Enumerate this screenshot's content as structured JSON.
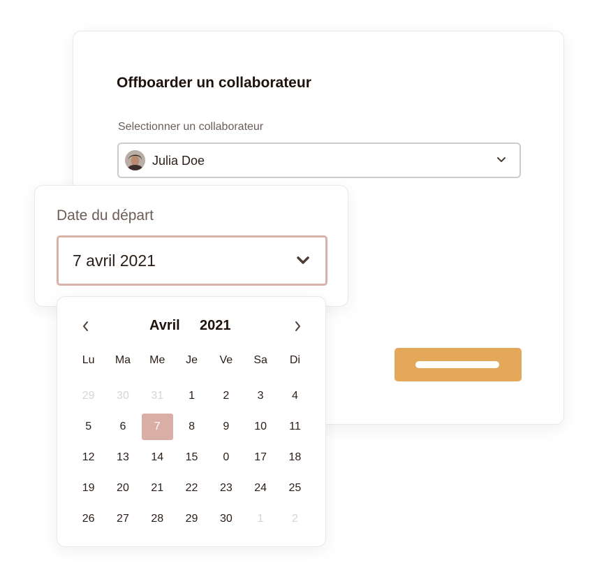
{
  "main_card": {
    "title": "Offboarder un collaborateur",
    "select_label": "Selectionner un collaborateur",
    "selected_collaborator": "Julia Doe"
  },
  "date_card": {
    "label": "Date du départ",
    "value": "7 avril 2021"
  },
  "calendar": {
    "month": "Avril",
    "year": "2021",
    "weekdays": [
      "Lu",
      "Ma",
      "Me",
      "Je",
      "Ve",
      "Sa",
      "Di"
    ],
    "days": [
      {
        "label": "29",
        "muted": true
      },
      {
        "label": "30",
        "muted": true
      },
      {
        "label": "31",
        "muted": true
      },
      {
        "label": "1"
      },
      {
        "label": "2"
      },
      {
        "label": "3"
      },
      {
        "label": "4"
      },
      {
        "label": "5"
      },
      {
        "label": "6"
      },
      {
        "label": "7",
        "selected": true
      },
      {
        "label": "8"
      },
      {
        "label": "9"
      },
      {
        "label": "10"
      },
      {
        "label": "11"
      },
      {
        "label": "12"
      },
      {
        "label": "13"
      },
      {
        "label": "14"
      },
      {
        "label": "15"
      },
      {
        "label": "0"
      },
      {
        "label": "17"
      },
      {
        "label": "18"
      },
      {
        "label": "19"
      },
      {
        "label": "20"
      },
      {
        "label": "21"
      },
      {
        "label": "22"
      },
      {
        "label": "23"
      },
      {
        "label": "24"
      },
      {
        "label": "25"
      },
      {
        "label": "26"
      },
      {
        "label": "27"
      },
      {
        "label": "28"
      },
      {
        "label": "29"
      },
      {
        "label": "30"
      },
      {
        "label": "1",
        "muted": true
      },
      {
        "label": "2",
        "muted": true
      }
    ]
  },
  "colors": {
    "accent_button": "#e4a85a",
    "selected_day": "#d9aea5",
    "date_field_border": "#d9b1a8"
  },
  "icons": {
    "collab_chevron": "chevron-down-icon",
    "date_chevron": "chevron-down-icon",
    "prev": "chevron-left-icon",
    "next": "chevron-right-icon"
  }
}
